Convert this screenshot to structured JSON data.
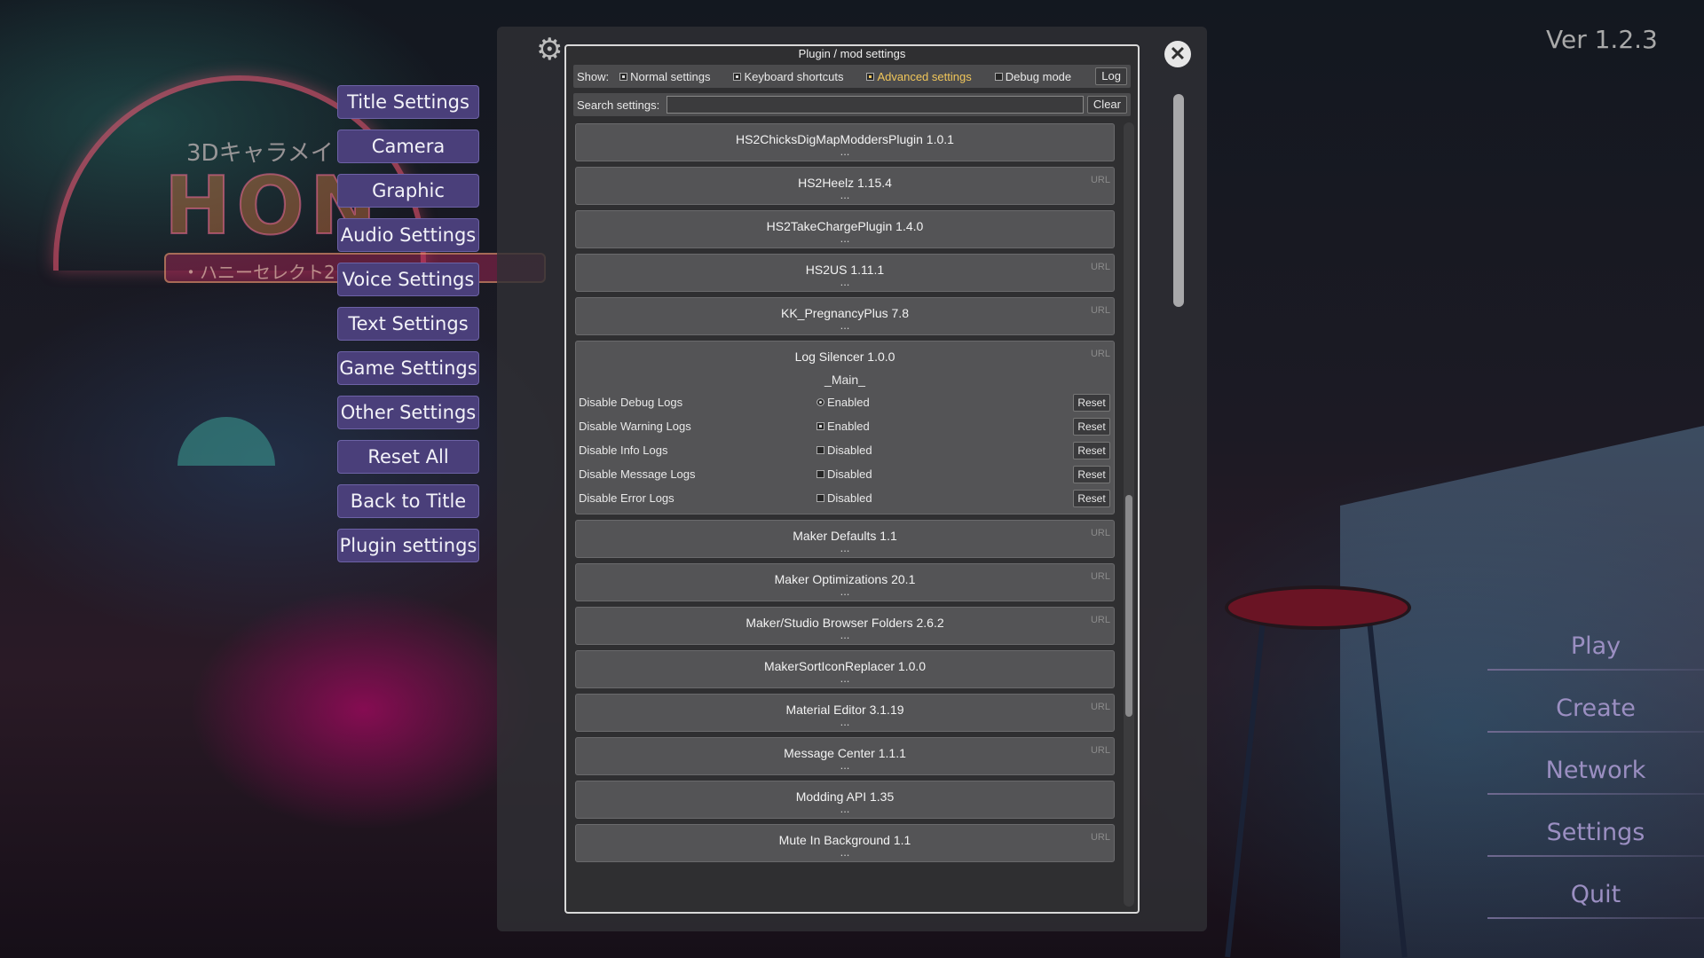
{
  "background": {
    "logo_text": "HON",
    "logo_sub": "3Dキャラメイ",
    "logo_banner": "・ハニーセレクト2"
  },
  "version": "Ver 1.2.3",
  "left_menu": [
    "Title Settings",
    "Camera",
    "Graphic",
    "Audio Settings",
    "Voice Settings",
    "Text Settings",
    "Game Settings",
    "Other Settings",
    "Reset All",
    "Back to Title",
    "Plugin settings"
  ],
  "right_menu": [
    "Play",
    "Create",
    "Network",
    "Settings",
    "Quit"
  ],
  "dialog": {
    "title": "Plugin / mod settings",
    "show_label": "Show:",
    "toggles": {
      "normal": "Normal settings",
      "keyboard": "Keyboard shortcuts",
      "advanced": "Advanced settings",
      "debug": "Debug mode"
    },
    "log_label": "Log",
    "search_label": "Search settings:",
    "search_value": "",
    "clear_label": "Clear",
    "url_label": "URL",
    "dots": "...",
    "plugins": [
      {
        "name": "HS2ChicksDigMapModdersPlugin 1.0.1",
        "url": false
      },
      {
        "name": "HS2Heelz 1.15.4",
        "url": true
      },
      {
        "name": "HS2TakeChargePlugin 1.4.0",
        "url": false
      },
      {
        "name": "HS2US 1.11.1",
        "url": true
      },
      {
        "name": "KK_PregnancyPlus 7.8",
        "url": true
      }
    ],
    "expanded_plugin": {
      "name": "Log Silencer 1.0.0",
      "section": "_Main_",
      "settings": [
        {
          "name": "Disable Debug Logs",
          "value": "Enabled",
          "checked": true
        },
        {
          "name": "Disable Warning Logs",
          "value": "Enabled",
          "checked": true
        },
        {
          "name": "Disable Info Logs",
          "value": "Disabled",
          "checked": false
        },
        {
          "name": "Disable Message Logs",
          "value": "Disabled",
          "checked": false
        },
        {
          "name": "Disable Error Logs",
          "value": "Disabled",
          "checked": false
        }
      ],
      "reset_label": "Reset"
    },
    "plugins_after": [
      {
        "name": "Maker Defaults 1.1",
        "url": true
      },
      {
        "name": "Maker Optimizations 20.1",
        "url": true
      },
      {
        "name": "Maker/Studio Browser Folders 2.6.2",
        "url": true
      },
      {
        "name": "MakerSortIconReplacer 1.0.0",
        "url": false
      },
      {
        "name": "Material Editor 3.1.19",
        "url": true
      },
      {
        "name": "Message Center 1.1.1",
        "url": true
      },
      {
        "name": "Modding API 1.35",
        "url": false
      },
      {
        "name": "Mute In Background 1.1",
        "url": true
      }
    ]
  }
}
